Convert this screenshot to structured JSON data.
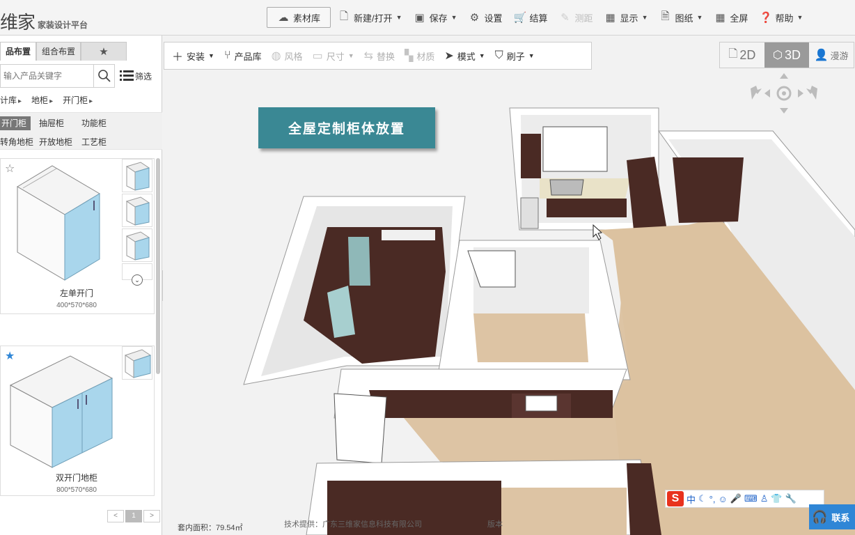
{
  "app": {
    "logo_text": "维家",
    "subtitle": "家装设计平台"
  },
  "top_menu": {
    "material_lib": "素材库",
    "new_open": "新建/打开",
    "save": "保存",
    "settings": "设置",
    "checkout": "结算",
    "measure": "测距",
    "display": "显示",
    "drawings": "图纸",
    "fullscreen": "全屏",
    "help": "帮助"
  },
  "left_panel": {
    "tabs": [
      "品布置",
      "组合布置"
    ],
    "search_placeholder": "输入产品关键字",
    "filter_label": "筛选",
    "breadcrumbs": [
      "计库",
      "地柜",
      "开门柜"
    ],
    "categories": [
      "开门柜",
      "抽屉柜",
      "功能柜",
      "转角地柜",
      "开放地柜",
      "工艺柜"
    ],
    "active_category": "开门柜",
    "products": [
      {
        "name": "左单开门",
        "dims": "400*570*680",
        "favorited": false
      },
      {
        "name": "双开门地柜",
        "dims": "800*570*680",
        "favorited": true
      }
    ],
    "pager": {
      "prev": "<",
      "current": "1",
      "next": ">"
    }
  },
  "sub_toolbar": {
    "install": "安装",
    "product_lib": "产品库",
    "style": "风格",
    "size": "尺寸",
    "replace": "替换",
    "material": "材质",
    "mode": "模式",
    "brush": "刷子"
  },
  "viewport": {
    "banner": "全屋定制柜体放置",
    "view_2d": "2D",
    "view_3d": "3D",
    "view_walk": "漫游",
    "active_view": "3D"
  },
  "status": {
    "area_label": "套内面积：79.54㎡",
    "tech_support": "技术提供：广东三维家信息科技有限公司",
    "version": "版本"
  },
  "ime": {
    "mode": "中"
  },
  "contact": {
    "label": "联系"
  },
  "colors": {
    "banner": "#3a8894",
    "floor": "#ddc4a4",
    "cabinet": "#4a2a24",
    "product_door": "#a9d6ec"
  }
}
